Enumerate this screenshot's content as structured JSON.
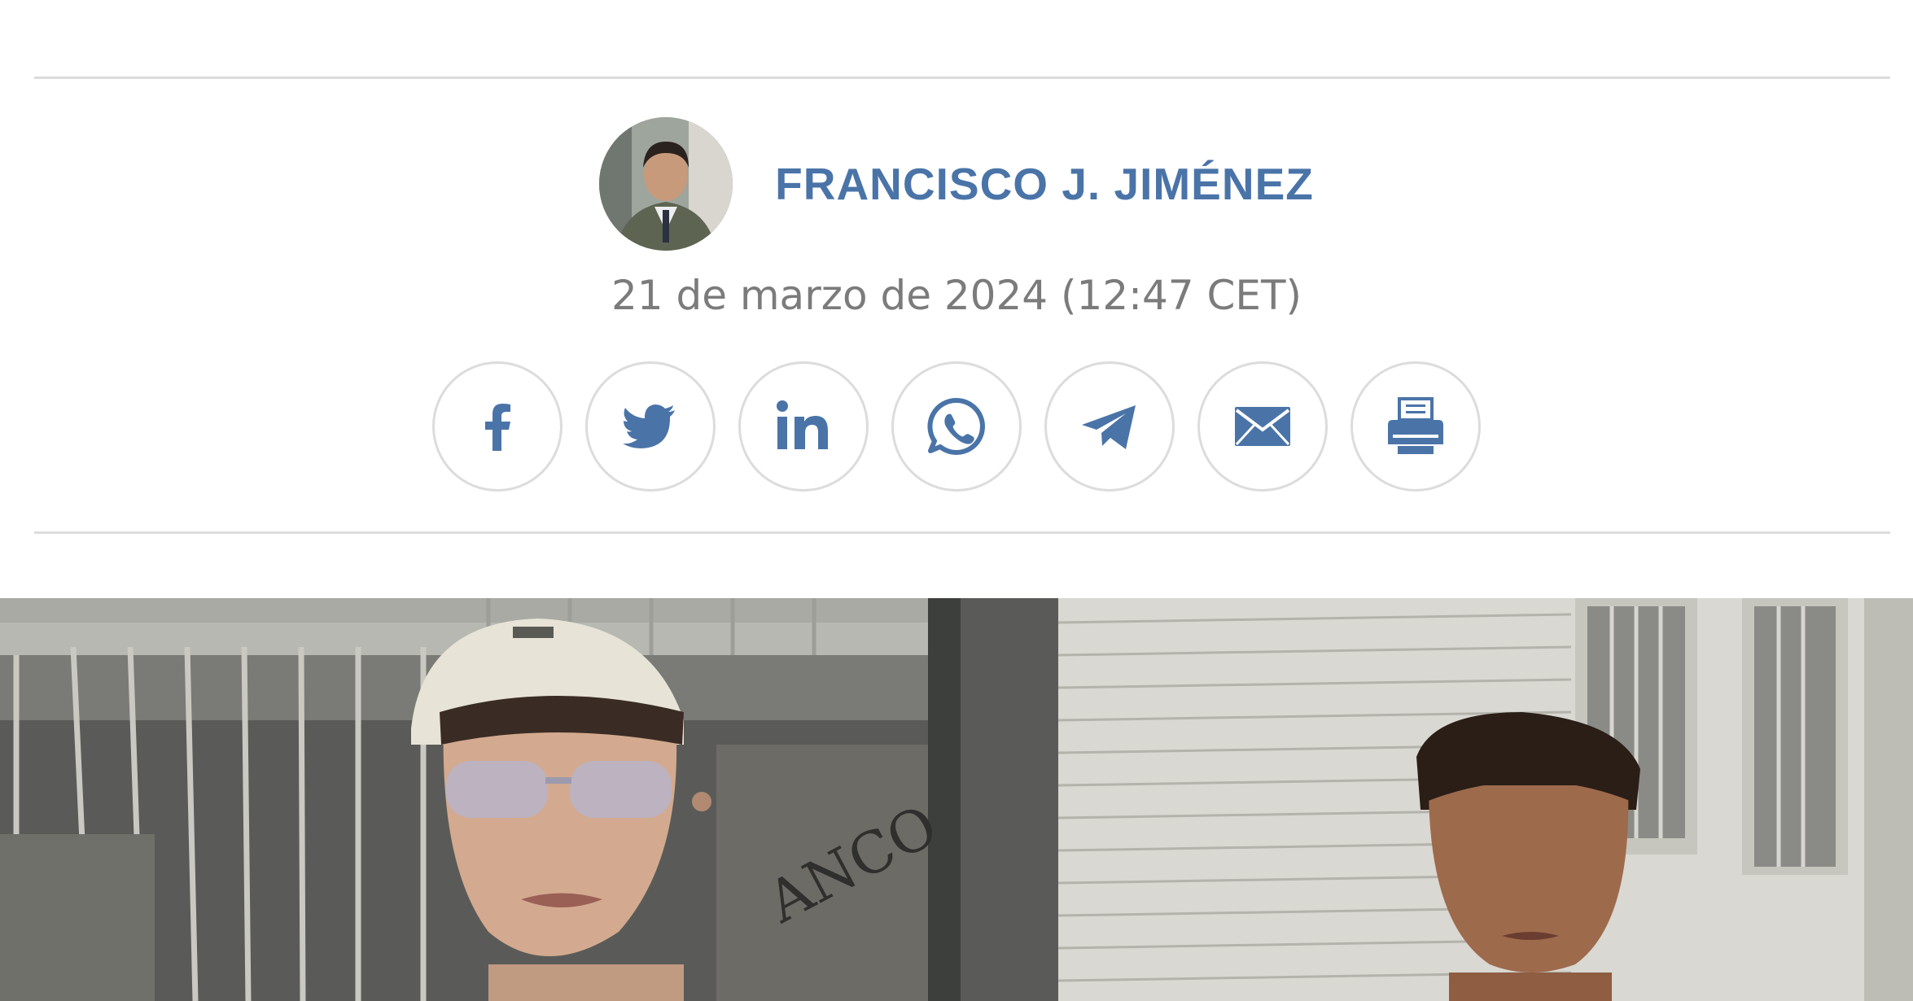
{
  "author": {
    "name": "FRANCISCO J. JIMÉNEZ",
    "avatar_icon": "author-portrait"
  },
  "article": {
    "date": "21 de marzo de 2024 (12:47 CET)"
  },
  "share": {
    "accent": "#4a74a8",
    "buttons": [
      {
        "network": "facebook",
        "icon": "facebook-icon"
      },
      {
        "network": "twitter",
        "icon": "twitter-icon"
      },
      {
        "network": "linkedin",
        "icon": "linkedin-icon"
      },
      {
        "network": "whatsapp",
        "icon": "whatsapp-icon"
      },
      {
        "network": "telegram",
        "icon": "telegram-icon"
      },
      {
        "network": "email",
        "icon": "mail-icon"
      },
      {
        "network": "print",
        "icon": "printer-icon"
      }
    ]
  },
  "photo": {
    "sign_text": "ANCO"
  }
}
